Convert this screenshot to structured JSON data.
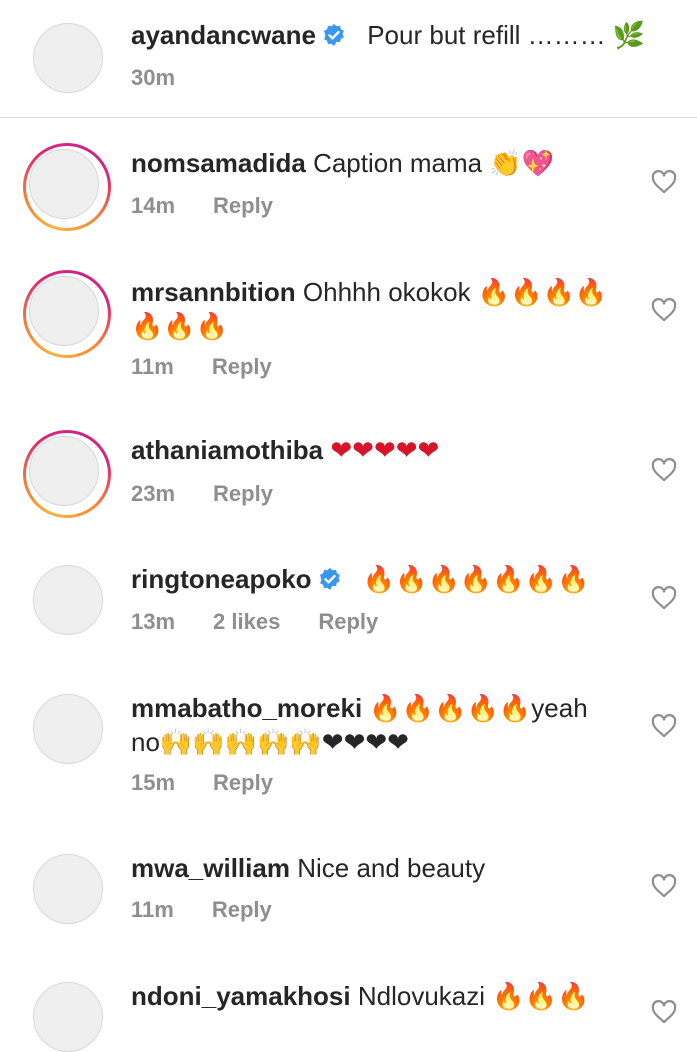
{
  "caption": {
    "username": "ayandancwane",
    "text": "Pour but refill ……… 🌿",
    "time": "30m"
  },
  "comments": [
    {
      "username": "nomsamadida",
      "text": "Caption mama 👏💖",
      "time": "14m",
      "likes": "",
      "reply": "Reply",
      "story_ring": true,
      "verified": false
    },
    {
      "username": "mrsannbition",
      "text": "Ohhhh okokok 🔥🔥🔥🔥",
      "text2": "🔥🔥🔥",
      "time": "11m",
      "likes": "",
      "reply": "Reply",
      "story_ring": true,
      "verified": false
    },
    {
      "username": "athaniamothiba",
      "text": "❤❤❤❤❤",
      "time": "23m",
      "likes": "",
      "reply": "Reply",
      "story_ring": true,
      "verified": false
    },
    {
      "username": "ringtoneapoko",
      "text": "🔥🔥🔥🔥🔥🔥🔥",
      "time": "13m",
      "likes": "2 likes",
      "reply": "Reply",
      "story_ring": false,
      "verified": true
    },
    {
      "username": "mmabatho_moreki",
      "text": "🔥🔥🔥🔥🔥yeah",
      "text2": "no🙌🙌🙌🙌🙌❤❤❤❤",
      "time": "15m",
      "likes": "",
      "reply": "Reply",
      "story_ring": false,
      "verified": false
    },
    {
      "username": "mwa_william",
      "text": "Nice and beauty",
      "time": "11m",
      "likes": "",
      "reply": "Reply",
      "story_ring": false,
      "verified": false
    },
    {
      "username": "ndoni_yamakhosi",
      "text": "Ndlovukazi 🔥🔥🔥",
      "time": "",
      "likes": "",
      "reply": "",
      "story_ring": false,
      "verified": false
    }
  ],
  "colors": {
    "verified_blue": "#3897f0",
    "meta_gray": "#8e8e8e",
    "heart_outline": "#8e8e8e"
  },
  "icons": {
    "like": "heart-outline-icon",
    "verified": "verified-badge-icon"
  }
}
